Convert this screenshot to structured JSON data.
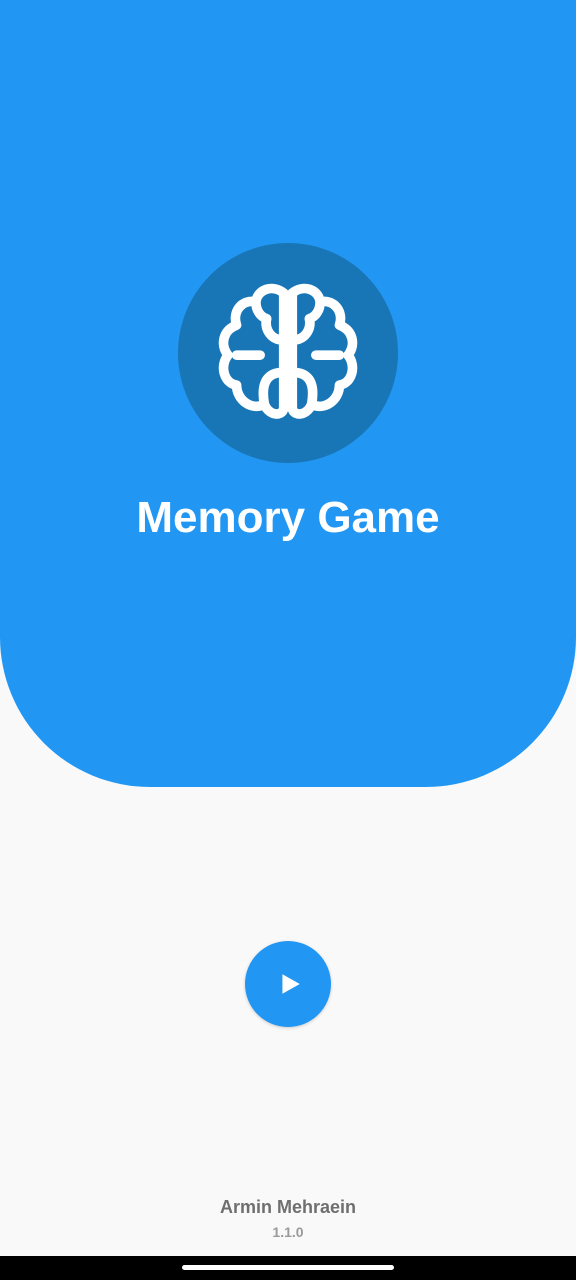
{
  "app": {
    "title": "Memory Game",
    "logo_icon": "brain-icon",
    "play_icon": "play-icon"
  },
  "footer": {
    "author": "Armin Mehraein",
    "version": "1.1.0"
  },
  "colors": {
    "primary": "#2196f3",
    "logo_circle": "#1976b6",
    "background": "#f9f9f9",
    "author_text": "#6f6f6f",
    "version_text": "#9a9a9a"
  }
}
